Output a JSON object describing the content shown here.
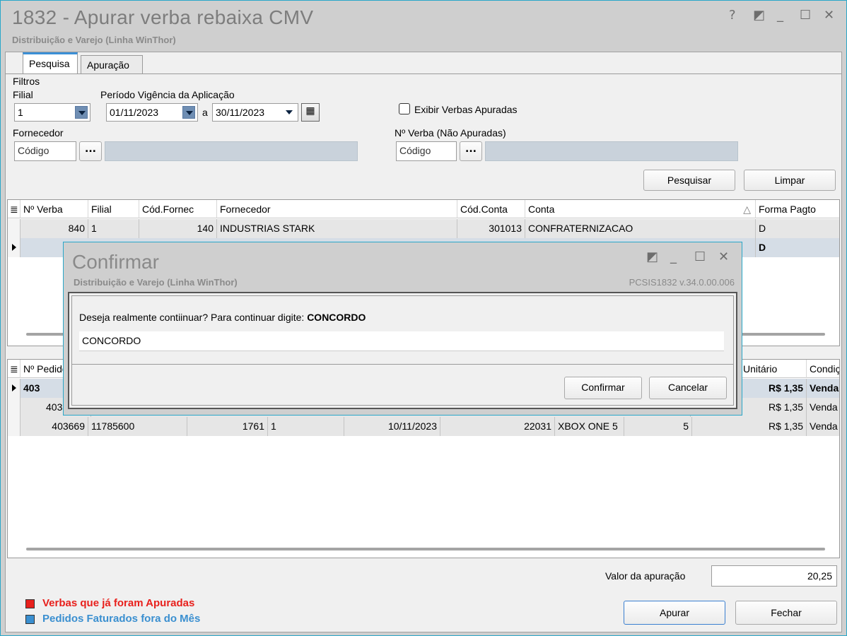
{
  "window": {
    "title": "1832 - Apurar verba rebaixa CMV",
    "subtitle": "Distribuição e Varejo (Linha WinThor)",
    "controls": {
      "help": "?",
      "restore": "◩",
      "minimize": "_",
      "maximize": "☐",
      "close": "✕"
    }
  },
  "tabs": [
    {
      "label": "Pesquisa",
      "active": true
    },
    {
      "label": "Apuração",
      "active": false
    }
  ],
  "filters": {
    "group_label": "Filtros",
    "filial_label": "Filial",
    "filial_value": "1",
    "periodo_label": "Período Vigência da Aplicação",
    "date_from": "01/11/2023",
    "date_sep": "a",
    "date_to": "30/11/2023",
    "exibir_label": "Exibir Verbas Apuradas",
    "exibir_checked": false,
    "fornecedor_label": "Fornecedor",
    "fornecedor_code_placeholder": "Código",
    "fornecedor_lookup": "...",
    "verba_label": "Nº Verba (Não Apuradas)",
    "verba_code_placeholder": "Código",
    "verba_lookup": "...",
    "pesquisar_label": "Pesquisar",
    "limpar_label": "Limpar"
  },
  "grid1": {
    "columns": [
      "Nº Verba",
      "Filial",
      "Cód.Fornec",
      "Fornecedor",
      "Cód.Conta",
      "Conta",
      "Forma Pagto"
    ],
    "sort_indicator": "△",
    "rows": [
      [
        "840",
        "1",
        "140",
        "INDUSTRIAS STARK",
        "301013",
        "CONFRATERNIZACAO",
        "D"
      ],
      [
        "",
        "",
        "",
        "",
        "",
        "",
        "D"
      ]
    ]
  },
  "grid2": {
    "columns": [
      "Nº Pedido",
      "Unitário",
      "Condiç"
    ],
    "rows": [
      {
        "pedido": "403",
        "valor": "R$ 1,35",
        "cond": "Venda"
      },
      {
        "pedido": "403",
        "valor": "R$ 1,35",
        "cond": "Venda"
      },
      {
        "pedido": "403669",
        "nf": "11785600",
        "cod": "1761",
        "filial": "1",
        "data": "10/11/2023",
        "codprod": "22031",
        "produto": "XBOX ONE 5",
        "qt": "5",
        "valor": "R$ 1,35",
        "cond": "Venda"
      }
    ]
  },
  "footer": {
    "valor_label": "Valor da apuração",
    "valor_value": "20,25",
    "legend1": "Verbas que já foram Apuradas",
    "legend1_color": "#e8201c",
    "legend2": "Pedidos Faturados fora do Mês",
    "legend2_color": "#3a8fd0",
    "apurar_label": "Apurar",
    "fechar_label": "Fechar"
  },
  "dialog": {
    "title": "Confirmar",
    "subtitle": "Distribuição e Varejo (Linha WinThor)",
    "version": "PCSIS1832  v.34.0.00.006",
    "prompt": "Deseja realmente contiinuar? Para continuar digite:",
    "keyword": "CONCORDO",
    "input_value": "CONCORDO",
    "confirm_label": "Confirmar",
    "cancel_label": "Cancelar",
    "controls": {
      "restore": "◩",
      "minimize": "_",
      "maximize": "☐",
      "close": "✕"
    }
  }
}
